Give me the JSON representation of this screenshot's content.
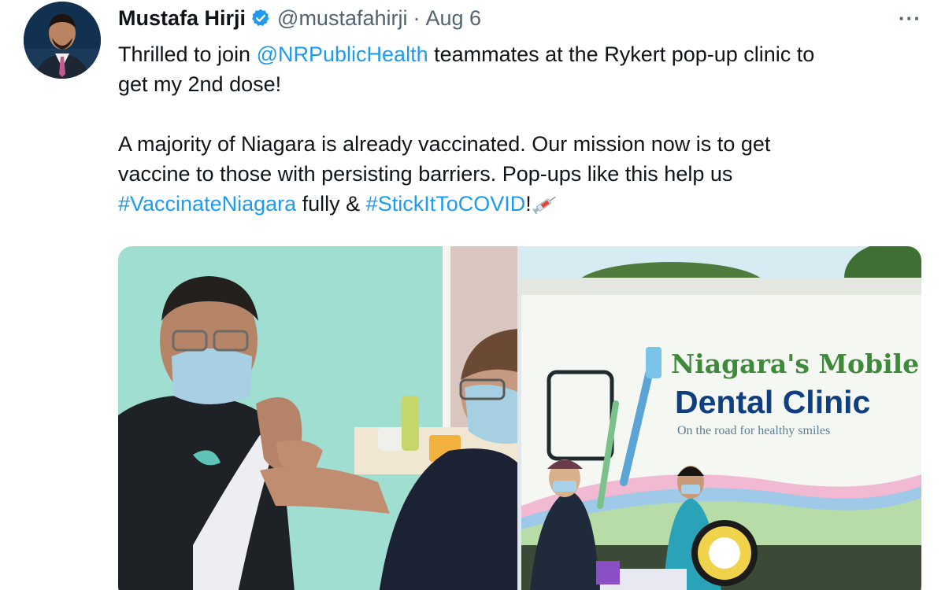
{
  "tweet": {
    "author_name": "Mustafa Hirji",
    "handle": "@mustafahirji",
    "separator": "·",
    "time": "Aug 6",
    "more_label": "···",
    "lines": {
      "l1_a": "Thrilled to join ",
      "l1_mention": "@NRPublicHealth",
      "l1_b": " teammates at the Rykert pop-up clinic to",
      "l2": "get my 2nd dose!",
      "l3": "A majority of Niagara is already vaccinated. Our mission now is to get",
      "l4": "vaccine to those with persisting barriers. Pop-ups like this help us",
      "l5_hashtag1": "#VaccinateNiagara",
      "l5_mid": " fully & ",
      "l5_hashtag2": "#StickItToCOVID",
      "l5_end": "!"
    },
    "link_color": "#1d9bf0",
    "verified_color": "#1d9bf0"
  },
  "media": {
    "right_photo": {
      "sign_line1": "Niagara's Mobile",
      "sign_line2": "Dental Clinic",
      "sign_tagline": "On the road for healthy smiles"
    }
  },
  "icons": {
    "verified": "verified-badge-icon",
    "more": "more-options-icon",
    "emoji": "syringe-emoji"
  }
}
